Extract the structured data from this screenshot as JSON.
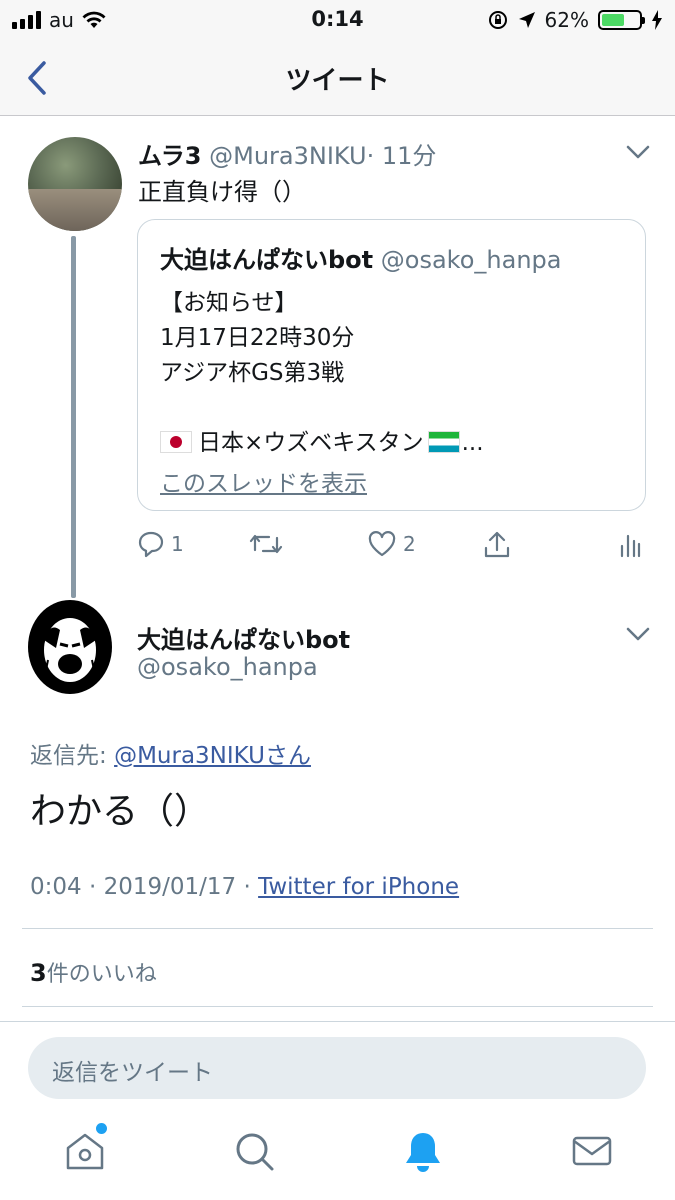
{
  "status_bar": {
    "carrier": "au",
    "time": "0:14",
    "battery_percent": "62%",
    "battery_level": 0.62
  },
  "nav": {
    "title": "ツイート",
    "back_icon": "chevron-left-icon"
  },
  "parent_tweet": {
    "name": "ムラ3",
    "handle": "@Mura3NIKU",
    "time": "· 11分",
    "text": "正直負け得（）",
    "quote": {
      "name": "大迫はんぱないbot",
      "handle": "@osako_hanpa",
      "lines": [
        "【お知らせ】",
        "1月17日22時30分",
        "アジア杯GS第3戦",
        ""
      ],
      "flag_line": "日本×ウズベキスタン",
      "flag_line_suffix": "...",
      "show_thread": "このスレッドを表示"
    },
    "actions": {
      "reply_count": "1",
      "retweet_count": "",
      "like_count": "2"
    }
  },
  "main_tweet": {
    "name": "大迫はんぱないbot",
    "handle": "@osako_hanpa",
    "reply_prefix": "返信先: ",
    "reply_to": "@Mura3NIKUさん",
    "text": "わかる（）",
    "time_date": "0:04 · 2019/01/17 · ",
    "source": "Twitter for iPhone",
    "likes_count": "3",
    "likes_label": "件のいいね"
  },
  "reply_bar": {
    "placeholder": "返信をツイート"
  },
  "tabs": [
    "home-icon",
    "search-icon",
    "notifications-icon",
    "messages-icon"
  ],
  "colors": {
    "accent": "#1da1f2",
    "link": "#3a5ba0",
    "secondary_text": "#657786",
    "battery": "#4cd964"
  }
}
